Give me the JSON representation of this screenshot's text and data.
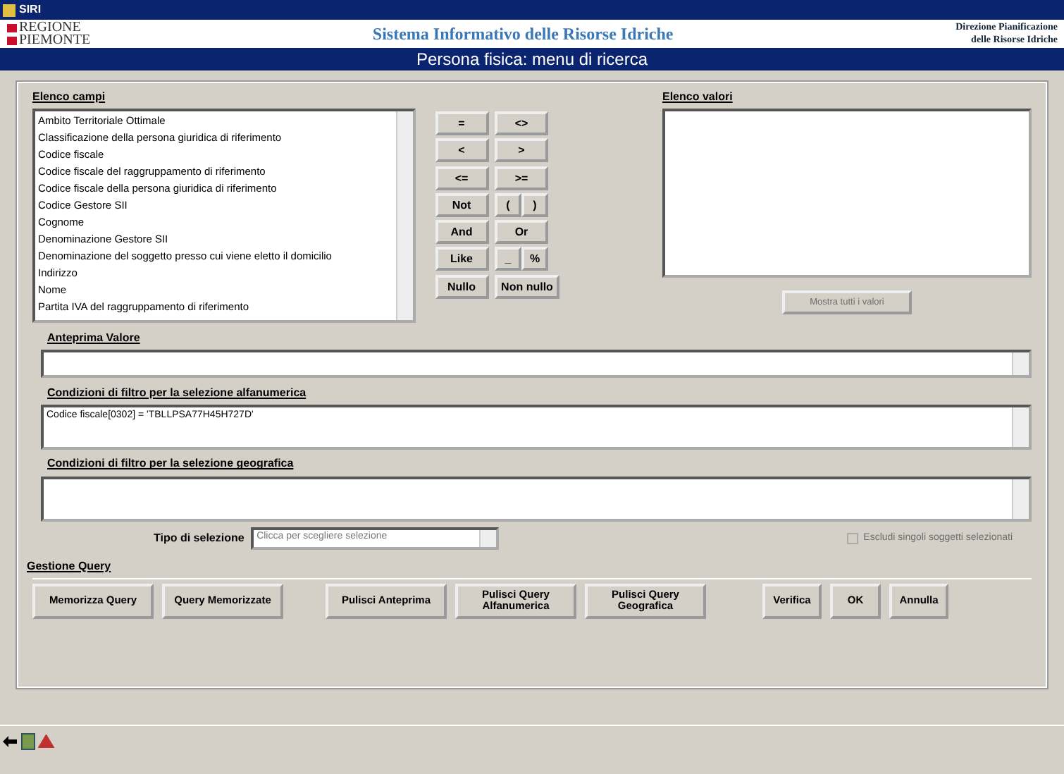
{
  "window": {
    "title": "SIRI"
  },
  "header": {
    "logo_lines": [
      "REGIONE",
      "PIEMONTE"
    ],
    "system_title": "Sistema Informativo delle Risorse Idriche",
    "department_lines": [
      "Direzione Pianificazione",
      "delle  Risorse  Idriche"
    ]
  },
  "page_title": "Persona fisica: menu di ricerca",
  "fields_list": {
    "label": "Elenco campi",
    "items": [
      {
        "text": "Ambito Territoriale Ottimale",
        "selected": false
      },
      {
        "text": "Classificazione della persona giuridica di riferimento",
        "selected": false
      },
      {
        "text": "Codice fiscale",
        "selected": false
      },
      {
        "text": "Codice fiscale del raggruppamento di riferimento",
        "selected": false
      },
      {
        "text": "Codice fiscale della persona giuridica di riferimento",
        "selected": false
      },
      {
        "text": "Codice Gestore SII",
        "selected": false
      },
      {
        "text": "Cognome",
        "selected": false
      },
      {
        "text": "Denominazione  Gestore SII",
        "selected": false
      },
      {
        "text": "Denominazione del soggetto presso cui viene eletto il domicilio",
        "selected": false
      },
      {
        "text": "Indirizzo",
        "selected": false
      },
      {
        "text": "Nome",
        "selected": false
      },
      {
        "text": "Partita IVA del raggruppamento di riferimento",
        "selected": false
      }
    ]
  },
  "operators": [
    [
      "=",
      "<>"
    ],
    [
      "<",
      ">"
    ],
    [
      "<=",
      ">="
    ],
    [
      "Not",
      "(",
      ")"
    ],
    [
      "And",
      "Or"
    ],
    [
      "Like",
      "_",
      "%"
    ],
    [
      "Nullo",
      "Non nullo"
    ]
  ],
  "values_list": {
    "label": "Elenco valori",
    "button": {
      "label": "Mostra tutti i valori",
      "disabled": true
    }
  },
  "preview": {
    "label": "Anteprima Valore"
  },
  "alpha_filter": {
    "label": "Condizioni di filtro per la selezione alfanumerica",
    "value": "Codice fiscale[0302] = 'TBLLPSA77H45H727D'"
  },
  "geo_filter": {
    "label": "Condizioni di filtro per la selezione geografica"
  },
  "selection_type": {
    "label": "Tipo di selezione",
    "placeholder": "Clicca per scegliere selezione",
    "disabled": true
  },
  "exclude_option": {
    "label": "Escludi singoli soggetti selezionati",
    "checked": false,
    "disabled": true
  },
  "query_group": {
    "label": "Gestione Query",
    "buttons": [
      {
        "label": "Memorizza Query"
      },
      {
        "label": "Query Memorizzate"
      },
      {
        "label": "Pulisci Anteprima"
      },
      {
        "label": "Pulisci Query\nAlfanumerica"
      },
      {
        "label": "Pulisci Query\nGeografica"
      },
      {
        "label": "Verifica"
      },
      {
        "label": "OK"
      },
      {
        "label": "Annulla"
      }
    ]
  }
}
